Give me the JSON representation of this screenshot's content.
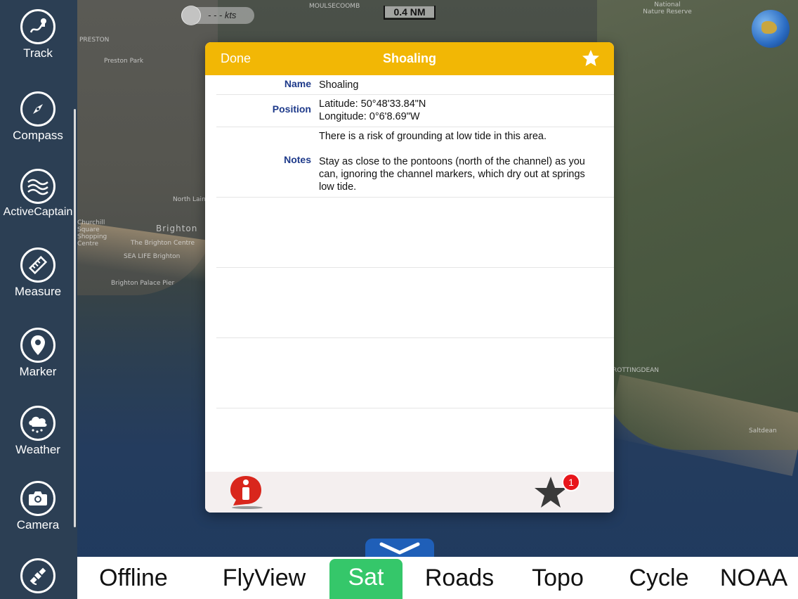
{
  "map": {
    "labels": [
      {
        "text": "PRESTON"
      },
      {
        "text": "Preston Park"
      },
      {
        "text": "North Laine"
      },
      {
        "text": "Churchill Square Shopping Centre"
      },
      {
        "text": "Brighton"
      },
      {
        "text": "The Brighton Centre"
      },
      {
        "text": "SEA LIFE Brighton"
      },
      {
        "text": "Brighton Palace Pier"
      },
      {
        "text": "MOULSECOOMB"
      },
      {
        "text": "National Nature Reserve"
      },
      {
        "text": "ROTTINGDEAN"
      },
      {
        "text": "Saltdean"
      }
    ],
    "speed": "- - - kts",
    "scale": "0.4 NM"
  },
  "sidebar": {
    "items": [
      {
        "label": "Track",
        "icon": "track-icon"
      },
      {
        "label": "Compass",
        "icon": "compass-icon"
      },
      {
        "label": "ActiveCaptain",
        "icon": "activecaptain-icon"
      },
      {
        "label": "Measure",
        "icon": "ruler-icon"
      },
      {
        "label": "Marker",
        "icon": "marker-icon"
      },
      {
        "label": "Weather",
        "icon": "weather-icon"
      },
      {
        "label": "Camera",
        "icon": "camera-icon"
      },
      {
        "label": "",
        "icon": "satellite-icon"
      }
    ]
  },
  "dialog": {
    "done_label": "Done",
    "title": "Shoaling",
    "name_key": "Name",
    "name_value": "Shoaling",
    "position_key": "Position",
    "latitude": "Latitude: 50°48'33.84\"N",
    "longitude": "Longitude: 0°6'8.69\"W",
    "notes_key": "Notes",
    "notes_line1": "There is a risk of grounding at low tide in this area.",
    "notes_line2": "Stay as close to the pontoons (north of the channel) as you can, ignoring the channel markers, which dry out at springs low tide.",
    "badge_count": "1"
  },
  "bottombar": {
    "tabs": [
      {
        "label": "Offline"
      },
      {
        "label": "FlyView"
      },
      {
        "label": "Sat",
        "active": true
      },
      {
        "label": "Roads"
      },
      {
        "label": "Topo"
      },
      {
        "label": "Cycle"
      },
      {
        "label": "NOAA"
      }
    ]
  },
  "colors": {
    "sidebar": "#2c3f54",
    "dialog_header": "#f2b705",
    "active_tab": "#35c76a",
    "key_text": "#1e3a8a",
    "badge": "#e8161b"
  }
}
